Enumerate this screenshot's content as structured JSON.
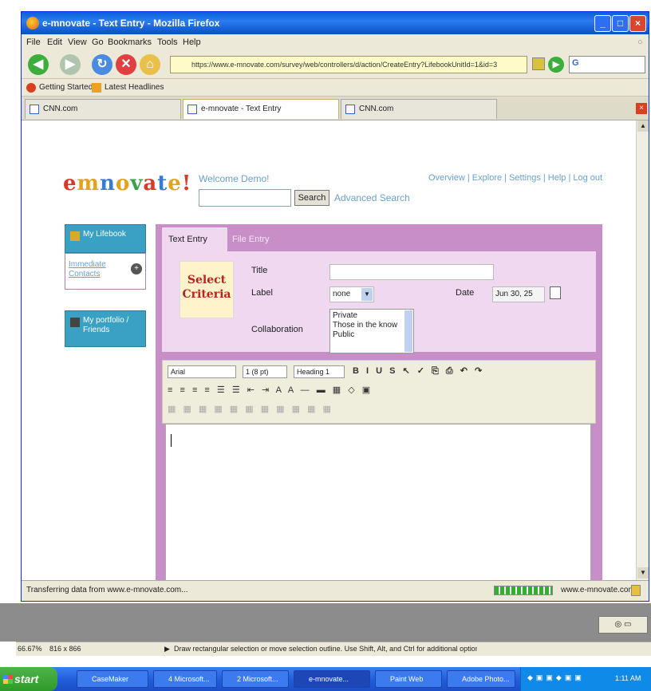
{
  "window": {
    "title": "e-mnovate - Text Entry - Mozilla Firefox",
    "menus": [
      "File",
      "Edit",
      "View",
      "Go",
      "Bookmarks",
      "Tools",
      "Help"
    ],
    "url": "https://www.e-mnovate.com/survey/web/controllers/d/action/CreateEntry?LifebookUnitId=1&id=3",
    "bookmarks": [
      "Getting Started",
      "Latest Headlines"
    ],
    "tabs": [
      "CNN.com",
      "e-mnovate - Text Entry",
      "CNN.com"
    ],
    "status": "Transferring data from www.e-mnovate.com...",
    "status_domain": "www.e-mnovate.com"
  },
  "page": {
    "logo": "e-mnovate!",
    "welcome": "Welcome Demo!",
    "search_button": "Search",
    "advanced_search": "Advanced Search",
    "top_links": "Overview | Explore | Settings | Help | Log out",
    "sidebar": {
      "box1_label": "My Lifebook",
      "box1_sub": "Immediate Contacts",
      "box2_label": "My portfolio / Friends"
    },
    "tabs": {
      "text_entry": "Text Entry",
      "file_entry": "File Entry"
    },
    "thumb_text": "Select Criteria",
    "form": {
      "title_label": "Title",
      "label_label": "Label",
      "label_value": "none",
      "date_label": "Date",
      "date_value": "Jun 30, 25",
      "collab_label": "Collaboration",
      "collab_options": [
        "Private",
        "Those in the know",
        "Public"
      ]
    },
    "toolbar": {
      "font": "Arial",
      "size": "1 (8 pt)",
      "format": "Heading 1",
      "row1_glyphs": "B I U S ↖ ✓ ⎘ ⎙ ↶ ↷",
      "row2_glyphs": "≡ ≡ ≡ ≡ ☰ ☰ ⇤ ⇥ A A — ▬ ▦ ◇ ▣",
      "row3_glyphs": "▦ ▦ ▦ ▦ ▦ ▦ ▦ ▦ ▦ ▦ ▦"
    }
  },
  "host": {
    "zoom": "66.67%",
    "size_info": "816 x 866",
    "hint": "Draw rectangular selection or move selection outline. Use Shift, Alt, and Ctrl for additional options."
  },
  "taskbar": {
    "start": "start",
    "items": [
      "CaseMaker",
      "4 Microsoft...",
      "2 Microsoft...",
      "e-mnovate...",
      "Paint Web",
      "Adobe Photo..."
    ],
    "clock": "1:11 AM"
  }
}
